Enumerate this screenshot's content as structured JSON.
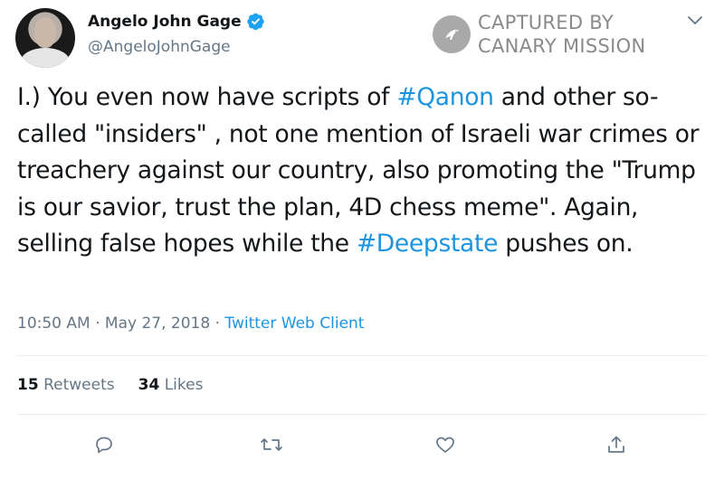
{
  "user": {
    "display_name": "Angelo John Gage",
    "handle": "@AngeloJohnGage",
    "verified": true
  },
  "watermark": {
    "line1": "CAPTURED BY",
    "line2": "CANARY MISSION"
  },
  "tweet": {
    "segments": [
      "I.) You even now have scripts of ",
      "#Qanon",
      " and other so-called \"insiders\" , not one mention of Israeli war crimes or treachery against our country, also promoting the \"Trump is our savior, trust the plan, 4D chess meme\". Again, selling false hopes while the ",
      "#Deepstate",
      " pushes on."
    ]
  },
  "meta": {
    "time": "10:50 AM",
    "separator": "·",
    "date": "May 27, 2018",
    "client": "Twitter Web Client"
  },
  "stats": {
    "retweets_count": "15",
    "retweets_label": "Retweets",
    "likes_count": "34",
    "likes_label": "Likes"
  },
  "colors": {
    "link": "#1b95e0",
    "muted": "#657786",
    "text": "#14171a",
    "divider": "#e6ecf0"
  },
  "icons": [
    "verified-icon",
    "chevron-down-icon",
    "reply-icon",
    "retweet-icon",
    "like-icon",
    "share-icon"
  ]
}
